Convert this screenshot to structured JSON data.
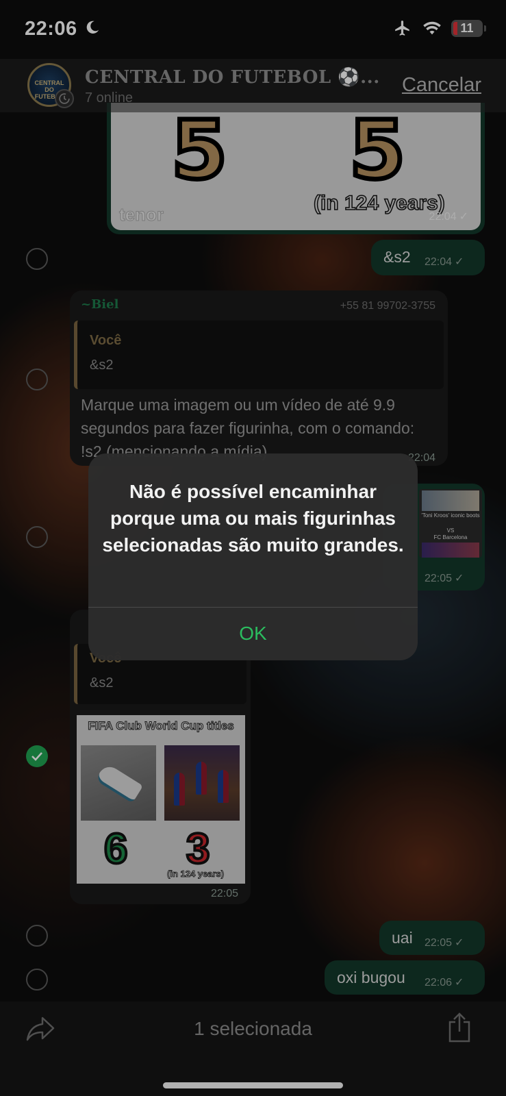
{
  "status_bar": {
    "time": "22:06",
    "battery": "11"
  },
  "header": {
    "group_name": "CENTRAL DO FUTEBOL ⚽...",
    "subtitle": "7 online",
    "cancel_label": "Cancelar",
    "avatar_text": "CENTRAL DO FUTEBOL"
  },
  "messages": {
    "gif": {
      "left_number": "5",
      "right_number": "5",
      "caption": "(in 124 years)",
      "watermark": "tenor",
      "time": "22:04"
    },
    "msg1": {
      "text": "&s2",
      "time": "22:04"
    },
    "msg2": {
      "sender": "~Biel",
      "phone": "+55 81 99702-3755",
      "quote_author": "Você",
      "quote_text": "&s2",
      "text": "Marque uma imagem ou um vídeo de até 9.9 segundos para fazer figurinha, com o comando: !s2 (mencionando a mídia)",
      "time": "22:04"
    },
    "msg3": {
      "time": "22:05",
      "thumb_title": "'Toni Kroos' iconic boots",
      "thumb_vs": "VS",
      "thumb_sub": "FC Barcelona"
    },
    "msg4": {
      "quote_author": "Você",
      "quote_text": "&s2",
      "image_title": "FIFA Club World Cup titles",
      "left_number": "6",
      "right_number": "3",
      "right_caption": "(in 124 years)",
      "time": "22:05"
    },
    "msg5": {
      "text": "uai",
      "time": "22:05"
    },
    "msg6": {
      "text": "oxi bugou",
      "time": "22:06"
    }
  },
  "alert": {
    "message": "Não é possível encaminhar porque uma ou mais figurinhas selecionadas são muito grandes.",
    "ok_label": "OK"
  },
  "toolbar": {
    "selected_label": "1 selecionada"
  },
  "colors": {
    "accent_green": "#2bbd5f",
    "outgoing_bubble": "#12382a",
    "incoming_bubble": "#1a1a1a",
    "battery_low": "#e0323a"
  }
}
